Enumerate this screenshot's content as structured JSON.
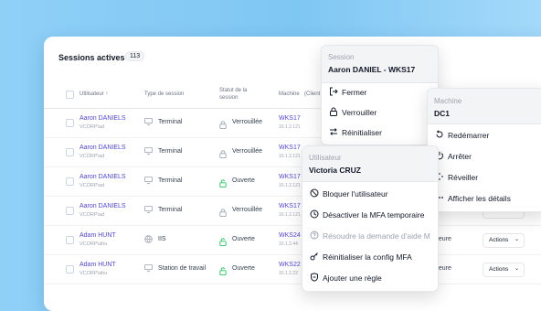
{
  "sessions": {
    "title": "Sessions actives",
    "count": "113",
    "columns": {
      "user": "Utilisateur ↑",
      "type": "Type de session",
      "status_line1": "Statut de la",
      "status_line2": "session",
      "machine": "Machine",
      "client": "(Client"
    },
    "rows": [
      {
        "name": "Aaron DANIELS",
        "domain": "VCORP\\ad",
        "type": "Terminal",
        "type_icon": "monitor-icon",
        "status": "Verrouillée",
        "status_icon": "lock-closed-icon",
        "machine": "WKS17",
        "ip": "10.1.2.121",
        "duration": "",
        "action": ""
      },
      {
        "name": "Aaron DANIELS",
        "domain": "VCORP\\ad",
        "type": "Terminal",
        "type_icon": "monitor-icon",
        "status": "Verrouillée",
        "status_icon": "lock-closed-icon",
        "machine": "WKS17",
        "ip": "10.1.2.121",
        "duration": "",
        "action": ""
      },
      {
        "name": "Aaron DANIELS",
        "domain": "VCORP\\ad",
        "type": "Terminal",
        "type_icon": "monitor-icon",
        "status": "Ouverte",
        "status_icon": "lock-open-icon",
        "machine": "WKS17",
        "ip": "10.1.2.121",
        "duration": "",
        "action": ""
      },
      {
        "name": "Aaron DANIELS",
        "domain": "VCORP\\ad",
        "type": "Terminal",
        "type_icon": "monitor-icon",
        "status": "Verrouillée",
        "status_icon": "lock-closed-icon",
        "machine": "WKS17",
        "ip": "10.1.2.121",
        "duration": "jours",
        "action": "Actions"
      },
      {
        "name": "Adam HUNT",
        "domain": "VCORP\\ahu",
        "type": "IIS",
        "type_icon": "globe-icon",
        "status": "Ouverte",
        "status_icon": "lock-open-icon",
        "machine": "WKS24",
        "ip": "10.1.2.44",
        "duration": "heure",
        "action": "Actions"
      },
      {
        "name": "Adam HUNT",
        "domain": "VCORP\\ahu",
        "type": "Station de travail",
        "type_icon": "monitor-icon",
        "status": "Ouverte",
        "status_icon": "lock-open-icon",
        "machine": "WKS22",
        "ip": "10.1.2.22",
        "duration": "heure",
        "action": "Actions"
      }
    ]
  },
  "session_menu": {
    "caption": "Session",
    "subject": "Aaron DANIEL - WKS17",
    "items": [
      {
        "label": "Fermer",
        "icon": "logout-icon"
      },
      {
        "label": "Verrouiller",
        "icon": "lock-icon"
      },
      {
        "label": "Réinitialiser",
        "icon": "refresh-arrows-icon"
      }
    ]
  },
  "machine_menu": {
    "caption": "Machine",
    "subject": "DC1",
    "items": [
      {
        "label": "Redémarrer",
        "icon": "restart-icon"
      },
      {
        "label": "Arrêter",
        "icon": "power-icon"
      },
      {
        "label": "Réveiller",
        "icon": "wake-icon"
      },
      {
        "label": "Afficher les détails",
        "icon": "more-icon"
      }
    ]
  },
  "user_menu": {
    "caption": "Utilisateur",
    "subject": "Victoria CRUZ",
    "items": [
      {
        "label": "Bloquer l'utilisateur",
        "icon": "block-icon",
        "disabled": false
      },
      {
        "label": "Désactiver la MFA temporaire",
        "icon": "clock-icon",
        "disabled": false
      },
      {
        "label": "Résoudre la demande d'aide M",
        "icon": "help-icon",
        "disabled": true
      },
      {
        "label": "Réinitialiser la config MFA",
        "icon": "key-icon",
        "disabled": false
      },
      {
        "label": "Ajouter une règle",
        "icon": "shield-icon",
        "disabled": false
      }
    ]
  },
  "colors": {
    "accent": "#4f46e5",
    "open": "#22c55e",
    "muted": "#9ca3af",
    "background": "#85cbf5"
  }
}
